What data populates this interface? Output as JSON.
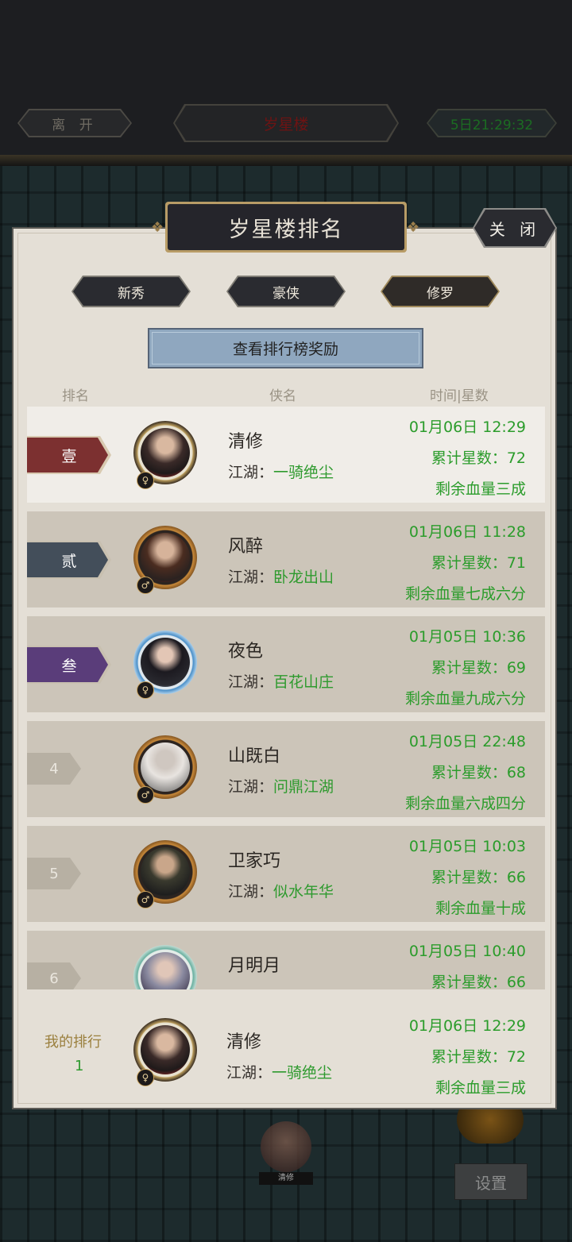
{
  "topbar": {
    "leave_label": "离 开",
    "title": "岁星楼",
    "timer": "5日21:29:32"
  },
  "panel": {
    "title": "岁星楼排名",
    "close_label": "关 闭",
    "tabs": [
      "新秀",
      "豪侠",
      "修罗"
    ],
    "reward_button": "查看排行榜奖励",
    "columns": {
      "rank": "排名",
      "name": "侠名",
      "time_stars": "时间|星数"
    },
    "rows": [
      {
        "rank": "壹",
        "name": "清修",
        "guild_prefix": "江湖：",
        "guild": "一骑绝尘",
        "time": "01月06日 12:29",
        "stars": "累计星数：72",
        "hp": "剩余血量三成",
        "gender": "♀"
      },
      {
        "rank": "贰",
        "name": "风醉",
        "guild_prefix": "江湖：",
        "guild": "卧龙出山",
        "time": "01月06日 11:28",
        "stars": "累计星数：71",
        "hp": "剩余血量七成六分",
        "gender": "♂"
      },
      {
        "rank": "叁",
        "name": "夜色",
        "guild_prefix": "江湖：",
        "guild": "百花山庄",
        "time": "01月05日 10:36",
        "stars": "累计星数：69",
        "hp": "剩余血量九成六分",
        "gender": "♀"
      },
      {
        "rank": "4",
        "name": "山既白",
        "guild_prefix": "江湖：",
        "guild": "问鼎江湖",
        "time": "01月05日 22:48",
        "stars": "累计星数：68",
        "hp": "剩余血量六成四分",
        "gender": "♂"
      },
      {
        "rank": "5",
        "name": "卫家巧",
        "guild_prefix": "江湖：",
        "guild": "似水年华",
        "time": "01月05日 10:03",
        "stars": "累计星数：66",
        "hp": "剩余血量十成",
        "gender": "♂"
      },
      {
        "rank": "6",
        "name": "月明月",
        "time": "01月05日 10:40",
        "stars": "累计星数：66",
        "gender": "♀"
      }
    ],
    "my_rank": {
      "label": "我的排行",
      "rank": "1",
      "name": "清修",
      "guild_prefix": "江湖：",
      "guild": "一骑绝尘",
      "time": "01月06日 12:29",
      "stars": "累计星数：72",
      "hp": "剩余血量三成",
      "gender": "♀"
    }
  },
  "scene": {
    "player_name": "清修",
    "settings_label": "设置"
  },
  "colors": {
    "rank1": "#7c3030",
    "rank2": "#434e5a",
    "rank3": "#5a3d7a",
    "stat_green": "#2b9c2b"
  },
  "icons": {
    "female": "female-symbol-icon",
    "male": "male-symbol-icon"
  }
}
